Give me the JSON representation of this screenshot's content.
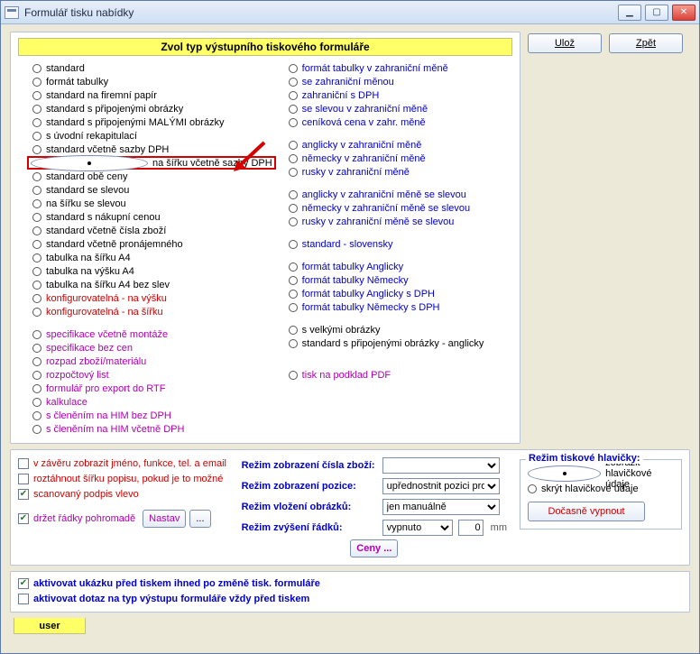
{
  "window": {
    "title": "Formulář tisku nabídky"
  },
  "header": {
    "yellow": "Zvol typ výstupního tiskového formuláře"
  },
  "buttons": {
    "save": "Ulož",
    "back": "Zpět",
    "nastav": "Nastav",
    "dots": "...",
    "ceny": "Ceny ...",
    "docasne": "Dočasně vypnout"
  },
  "left": [
    {
      "t": "standard",
      "c": "blk",
      "sel": false
    },
    {
      "t": "formát tabulky",
      "c": "blk",
      "sel": false
    },
    {
      "t": "standard na firemní papír",
      "c": "blk",
      "sel": false
    },
    {
      "t": "standard s připojenými obrázky",
      "c": "blk",
      "sel": false
    },
    {
      "t": "standard s připojenými MALÝMI obrázky",
      "c": "blk",
      "sel": false
    },
    {
      "t": "s úvodní rekapitulací",
      "c": "blk",
      "sel": false
    },
    {
      "t": "standard včetně sazby DPH",
      "c": "blk",
      "sel": false
    },
    {
      "t": "na šířku včetně sazby DPH",
      "c": "blk",
      "sel": true,
      "hl": true
    },
    {
      "t": "standard obě ceny",
      "c": "blk",
      "sel": false
    },
    {
      "t": "standard se slevou",
      "c": "blk",
      "sel": false
    },
    {
      "t": "na šířku se slevou",
      "c": "blk",
      "sel": false
    },
    {
      "t": "standard s nákupní cenou",
      "c": "blk",
      "sel": false
    },
    {
      "t": "standard včetně čísla zboží",
      "c": "blk",
      "sel": false
    },
    {
      "t": "standard včetně pronájemného",
      "c": "blk",
      "sel": false
    },
    {
      "t": "tabulka na šířku A4",
      "c": "blk",
      "sel": false
    },
    {
      "t": "tabulka na výšku A4",
      "c": "blk",
      "sel": false
    },
    {
      "t": "tabulka na šířku A4 bez slev",
      "c": "blk",
      "sel": false
    },
    {
      "t": "konfigurovatelná - na výšku",
      "c": "red",
      "sel": false
    },
    {
      "t": "konfigurovatelná - na šířku",
      "c": "red",
      "sel": false
    },
    {
      "sp": true
    },
    {
      "t": "specifikace včetně montáže",
      "c": "mag",
      "sel": false
    },
    {
      "t": "specifikace bez cen",
      "c": "mag",
      "sel": false
    },
    {
      "t": "rozpad zboží/materiálu",
      "c": "mag",
      "sel": false
    },
    {
      "t": "rozpočtový list",
      "c": "mag",
      "sel": false
    },
    {
      "t": "formulář pro export do RTF",
      "c": "mag",
      "sel": false
    },
    {
      "t": "kalkulace",
      "c": "mag",
      "sel": false
    },
    {
      "t": "s členěním na HIM bez DPH",
      "c": "mag",
      "sel": false
    },
    {
      "t": "s členěním na HIM včetně DPH",
      "c": "mag",
      "sel": false
    }
  ],
  "right": [
    {
      "t": "formát tabulky v zahraniční měně",
      "c": "blue",
      "sel": false
    },
    {
      "t": "se zahraniční měnou",
      "c": "blue",
      "sel": false
    },
    {
      "t": "zahraniční s DPH",
      "c": "blue",
      "sel": false
    },
    {
      "t": "se slevou v zahraniční měně",
      "c": "blue",
      "sel": false
    },
    {
      "t": "ceníková cena v zahr. měně",
      "c": "blue",
      "sel": false
    },
    {
      "sp": true
    },
    {
      "t": "anglicky v zahraniční měně",
      "c": "blue",
      "sel": false
    },
    {
      "t": "německy v zahraniční měně",
      "c": "blue",
      "sel": false
    },
    {
      "t": "rusky v zahraniční měně",
      "c": "blue",
      "sel": false
    },
    {
      "sp": true
    },
    {
      "t": "anglicky v zahraniční měně se slevou",
      "c": "blue",
      "sel": false
    },
    {
      "t": "německy v zahraniční měně se slevou",
      "c": "blue",
      "sel": false
    },
    {
      "t": "rusky v zahraniční měně se slevou",
      "c": "blue",
      "sel": false
    },
    {
      "sp": true
    },
    {
      "t": "standard - slovensky",
      "c": "blue",
      "sel": false
    },
    {
      "sp": true
    },
    {
      "t": "formát tabulky Anglicky",
      "c": "blue",
      "sel": false
    },
    {
      "t": "formát tabulky Německy",
      "c": "blue",
      "sel": false
    },
    {
      "t": "formát tabulky Anglicky s DPH",
      "c": "blue",
      "sel": false
    },
    {
      "t": "formát tabulky Německy s DPH",
      "c": "blue",
      "sel": false
    },
    {
      "sp": true
    },
    {
      "t": "s velkými obrázky",
      "c": "blk",
      "sel": false
    },
    {
      "t": "standard s připojenými obrázky - anglicky",
      "c": "blk",
      "sel": false
    },
    {
      "sp": true
    },
    {
      "sp": true
    },
    {
      "t": "tisk na podklad PDF",
      "c": "mag",
      "sel": false
    }
  ],
  "mid": {
    "chk1": {
      "label": "v závěru zobrazit jméno, funkce, tel. a email",
      "checked": false
    },
    "chk2": {
      "label": "roztáhnout šířku popisu, pokud je to možné",
      "checked": false
    },
    "chk3": {
      "label": "scanovaný podpis vlevo",
      "checked": true
    },
    "chk4": {
      "label": "držet řádky pohromadě",
      "checked": true
    },
    "fl1": "Režim zobrazení čísla zboží:",
    "fl2": "Režim zobrazení pozice:",
    "fl3": "Režim vložení obrázků:",
    "fl4": "Režim zvýšení řádků:",
    "sel1": "",
    "sel2": "upřednostnit pozici proje",
    "sel3": "jen manuálně",
    "sel4": "vypnuto",
    "num": "0",
    "mm": "mm",
    "fsLegend": "Režim tiskové hlavičky:",
    "rh1": "zobrazit hlavičkové údaje",
    "rh2": "skrýt hlavičkové údaje"
  },
  "bottom": {
    "chk1": {
      "label": "aktivovat ukázku před tiskem ihned po změně tisk. formuláře",
      "checked": true
    },
    "chk2": {
      "label": "aktivovat dotaz na typ výstupu formuláře vždy před tiskem",
      "checked": false
    }
  },
  "user": "user"
}
